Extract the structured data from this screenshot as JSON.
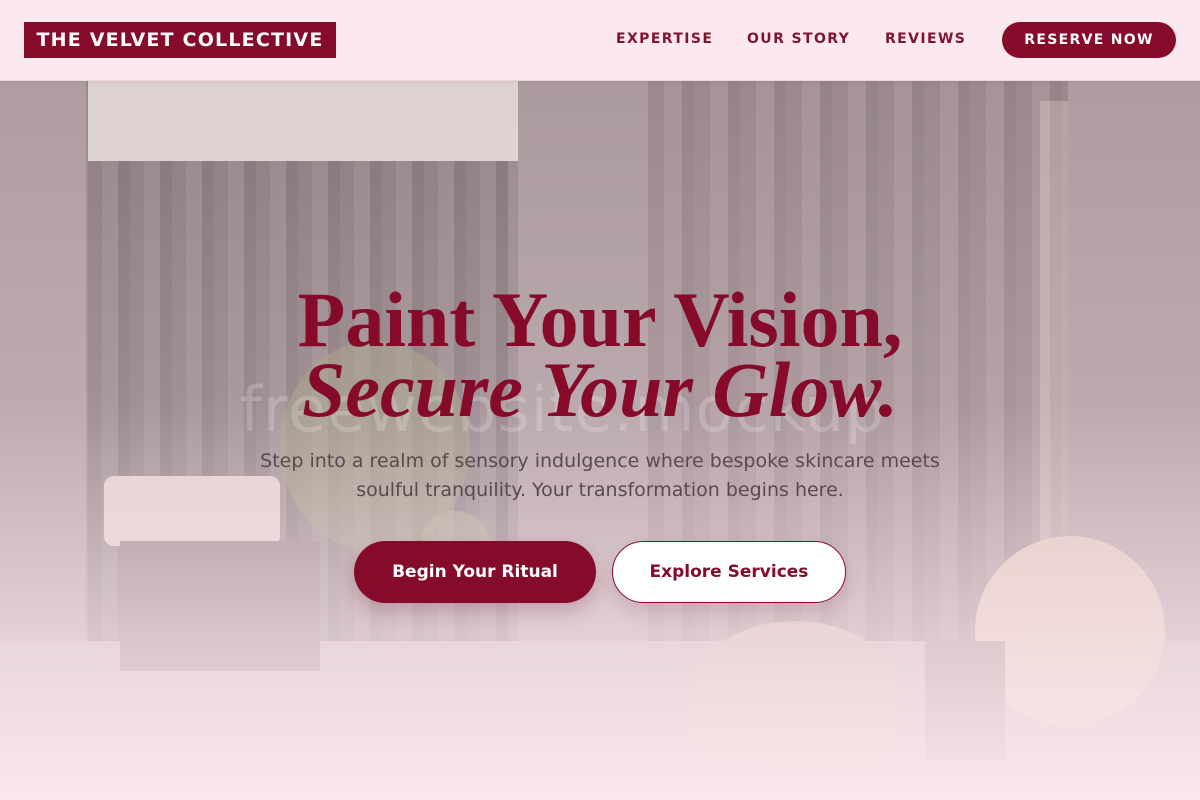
{
  "header": {
    "logo": "THE VELVET COLLECTIVE",
    "nav": [
      {
        "label": "EXPERTISE"
      },
      {
        "label": "OUR STORY"
      },
      {
        "label": "REVIEWS"
      }
    ],
    "cta": "RESERVE NOW"
  },
  "hero": {
    "headline_line1": "Paint Your Vision,",
    "headline_line2": "Secure Your Glow.",
    "watermark": "freewebsite.mockup",
    "subtitle": "Step into a realm of sensory indulgence where bespoke skincare meets soulful tranquility. Your transformation begins here.",
    "primary_button": "Begin Your Ritual",
    "secondary_button": "Explore Services"
  },
  "colors": {
    "brand": "#860b2b",
    "header_bg": "#fce9ef",
    "text_muted": "#5a4a50"
  }
}
